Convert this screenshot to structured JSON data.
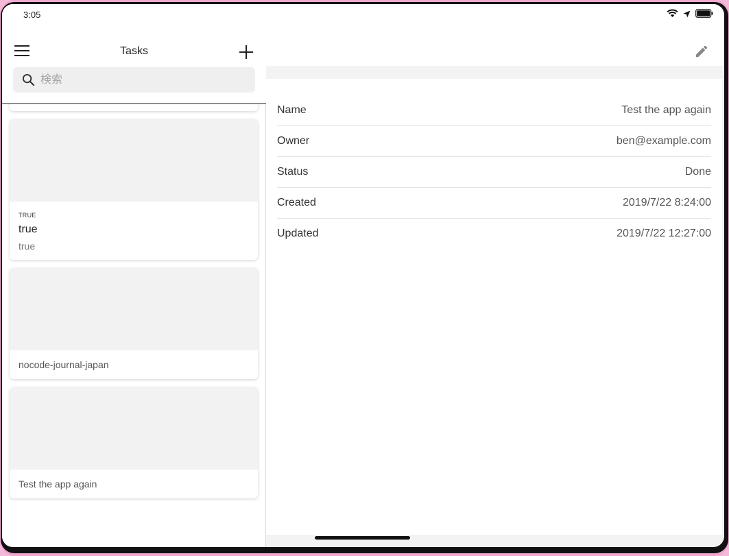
{
  "status_bar": {
    "time": "3:05",
    "icons": [
      "wifi-icon",
      "location-arrow-icon",
      "battery-icon"
    ]
  },
  "left_pane": {
    "title": "Tasks",
    "menu_icon": "hamburger-menu-icon",
    "add_icon": "plus-icon",
    "search": {
      "placeholder": "検索",
      "value": ""
    },
    "cards": [
      {
        "tag": "TRUE",
        "title": "true",
        "subtitle": "true"
      },
      {
        "title": "nocode-journal-japan"
      },
      {
        "title": "Test the app again"
      }
    ]
  },
  "right_pane": {
    "edit_icon": "pencil-icon",
    "details": [
      {
        "label": "Name",
        "value": "Test the app again"
      },
      {
        "label": "Owner",
        "value": "ben@example.com"
      },
      {
        "label": "Status",
        "value": "Done"
      },
      {
        "label": "Created",
        "value": "2019/7/22 8:24:00"
      },
      {
        "label": "Updated",
        "value": "2019/7/22 12:27:00"
      }
    ]
  },
  "colors": {
    "frame": "#f0a8cf",
    "bezel": "#111111",
    "placeholder_bg": "#f2f2f2",
    "pane_bg": "#f3f3f3"
  }
}
